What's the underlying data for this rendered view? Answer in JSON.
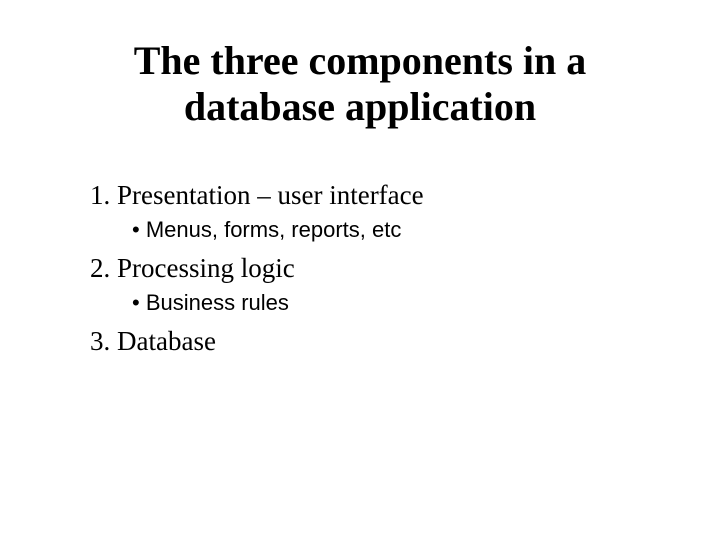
{
  "title": "The three components in a database application",
  "items": [
    {
      "label": "1. Presentation – user interface",
      "sub": "Menus, forms, reports, etc"
    },
    {
      "label": "2. Processing logic",
      "sub": "Business rules"
    },
    {
      "label": "3. Database",
      "sub": null
    }
  ]
}
